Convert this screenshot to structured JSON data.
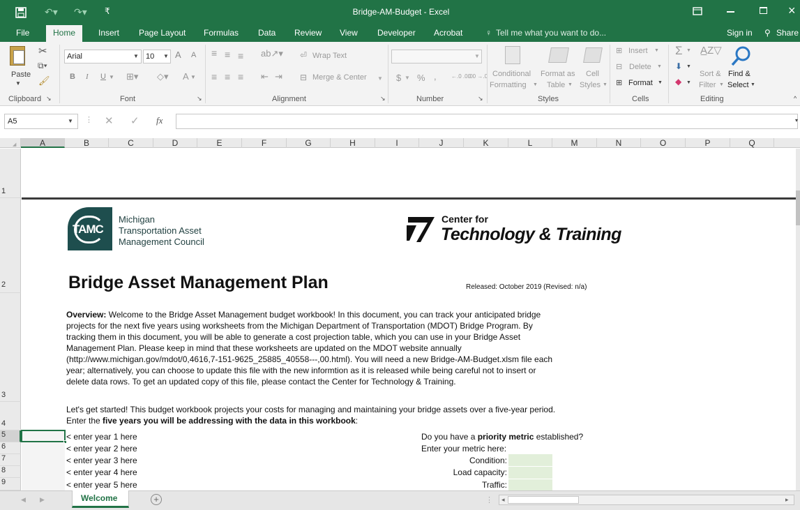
{
  "window": {
    "title": "Bridge-AM-Budget - Excel",
    "ribbon_display_icon": "ribbon-display-icon",
    "minimize_icon": "minimize-icon",
    "restore_icon": "restore-icon",
    "close_icon": "close-icon"
  },
  "qat": {
    "save_icon": "save-icon",
    "undo_icon": "undo-icon",
    "redo_icon": "redo-icon",
    "customize_icon": "customize-icon"
  },
  "menu": {
    "tabs": [
      "File",
      "Home",
      "Insert",
      "Page Layout",
      "Formulas",
      "Data",
      "Review",
      "View",
      "Developer",
      "Acrobat"
    ],
    "tell_me": "Tell me what you want to do...",
    "sign_in": "Sign in",
    "share": "Share"
  },
  "ribbon": {
    "clipboard": {
      "paste": "Paste",
      "group": "Clipboard"
    },
    "font": {
      "name": "Arial",
      "size": "10",
      "bold": "B",
      "italic": "I",
      "underline": "U",
      "grow": "A",
      "shrink": "A",
      "font_color": "A",
      "group": "Font"
    },
    "alignment": {
      "wrap_text": "Wrap Text",
      "merge_center": "Merge & Center",
      "group": "Alignment"
    },
    "number": {
      "format_value": "",
      "currency": "$",
      "percent": "%",
      "comma": ",",
      "inc_decimal": "←.0 .00",
      "dec_decimal": ".00 →.0",
      "group": "Number"
    },
    "styles": {
      "conditional_1": "Conditional",
      "conditional_2": "Formatting",
      "format_as_1": "Format as",
      "format_as_2": "Table",
      "cell_styles_1": "Cell",
      "cell_styles_2": "Styles",
      "group": "Styles"
    },
    "cells": {
      "insert": "Insert",
      "delete": "Delete",
      "format": "Format",
      "group": "Cells"
    },
    "editing": {
      "sort_1": "Sort &",
      "sort_2": "Filter",
      "find_1": "Find &",
      "find_2": "Select",
      "group": "Editing"
    }
  },
  "formula_bar": {
    "name_box": "A5",
    "fx": "fx",
    "value": ""
  },
  "columns": [
    "A",
    "B",
    "C",
    "D",
    "E",
    "F",
    "G",
    "H",
    "I",
    "J",
    "K",
    "L",
    "M",
    "N",
    "O",
    "P",
    "Q"
  ],
  "rows": [
    "1",
    "2",
    "3",
    "4",
    "5",
    "6",
    "7",
    "8",
    "9"
  ],
  "sheet": {
    "tamc_logo_text": "TAMC",
    "tamc_line1": "Michigan",
    "tamc_line2": "Transportation Asset",
    "tamc_line3": "Management Council",
    "ctt_line1": "Center for",
    "ctt_line2": "Technology & Training",
    "title": "Bridge Asset Management Plan",
    "released": "Released: October 2019 (Revised: n/a)",
    "overview_label": "Overview:",
    "overview_lines": [
      " Welcome to the Bridge Asset Management budget workbook!  In this document, you can track your anticipated bridge",
      "projects for the next five years using worksheets from the Michigan Department of Transportation (MDOT) Bridge Program. By",
      "tracking them in this document, you will be able to generate a cost projection table, which you can use in your Bridge Asset",
      "Management Plan. Please keep in mind that these worksheets are updated on the MDOT website annually",
      "(http://www.michigan.gov/mdot/0,4616,7-151-9625_25885_40558---,00.html). You will need a new Bridge-AM-Budget.xlsm file each",
      "year; alternatively, you can choose to update this file with the new informtion as it is released while being careful not to insert or",
      "delete data rows. To get an updated copy of this file, please contact the Center for Technology & Training."
    ],
    "start_line1": "Let's get started! This budget workbook projects your costs for managing and maintaining your bridge assets over a five-year period.",
    "start_line2_a": "Enter the ",
    "start_line2_b": "five years you will be addressing with the data in this workbook",
    "start_line2_c": ":",
    "year_prompts": [
      "< enter year 1 here",
      "< enter year 2 here",
      "< enter year 3 here",
      "< enter year 4 here",
      "< enter year 5 here"
    ],
    "priority_a": "Do you have a ",
    "priority_b": "priority metric",
    "priority_c": " established?",
    "enter_metric": "Enter your metric here:",
    "metrics": [
      "Condition:",
      "Load capacity:",
      "Traffic:"
    ]
  },
  "tabs": {
    "sheet_tab": "Welcome",
    "add_sheet_icon": "add-sheet-icon"
  }
}
